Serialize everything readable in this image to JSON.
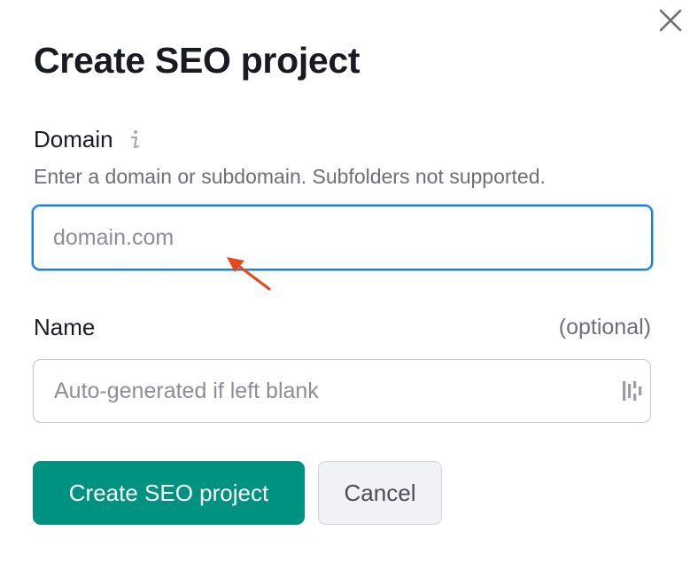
{
  "dialog": {
    "title": "Create SEO project"
  },
  "domain": {
    "label": "Domain",
    "hint": "Enter a domain or subdomain. Subfolders not supported.",
    "placeholder": "domain.com",
    "value": "",
    "info_icon": "info-icon"
  },
  "name": {
    "label": "Name",
    "optional_text": "(optional)",
    "placeholder": "Auto-generated if left blank",
    "value": "",
    "field_icon": "password-manager-icon"
  },
  "buttons": {
    "create_label": "Create SEO project",
    "cancel_label": "Cancel"
  },
  "colors": {
    "primary": "#009281",
    "focus_border": "#1a7fe0",
    "annotation_arrow": "#e8481c"
  }
}
